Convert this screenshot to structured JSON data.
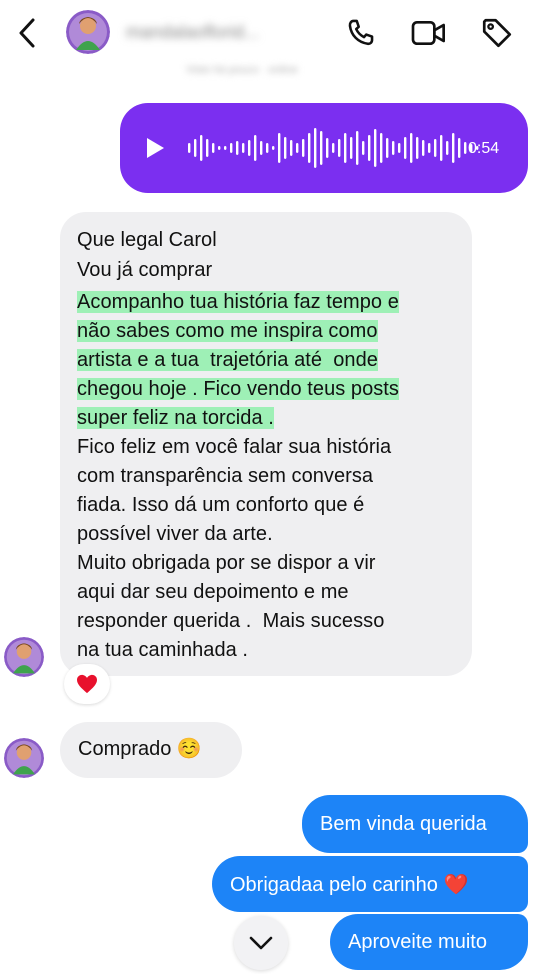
{
  "header": {
    "back_icon": "chevron-left-icon",
    "username": "mandalaoflorid...",
    "subtitle": "Visto há pouco · online",
    "call_icon": "phone-icon",
    "video_icon": "video-camera-icon",
    "tag_icon": "tag-icon"
  },
  "audio_message": {
    "duration": "0:54",
    "color": "#7b2ff0"
  },
  "incoming_message": {
    "lines": [
      "Que legal Carol",
      "Vou já comprar",
      "Acompanho tua história faz tempo e",
      "não sabes como me inspira como",
      "artista e a tua  trajetória até  onde",
      "chegou hoje . Fico vendo teus posts",
      "super feliz na torcida .",
      "Fico feliz em você falar sua história",
      "com transparência sem conversa",
      "fiada. Isso dá um conforto que é",
      "possível viver da arte.",
      "Muito obrigada por se dispor a vir",
      "aqui dar seu depoimento e me",
      "responder querida .  Mais sucesso",
      "na tua caminhada ."
    ],
    "highlight_color": "#9ef0b6",
    "reaction": "❤️"
  },
  "incoming_short": {
    "text": "Comprado ☺️"
  },
  "outgoing": {
    "msg1": "Bem vinda querida",
    "msg2": "Obrigadaa pelo carinho ❤️",
    "msg3": "Aproveite muito",
    "color": "#1d84f7"
  },
  "scroll_down_icon": "chevron-down-icon"
}
